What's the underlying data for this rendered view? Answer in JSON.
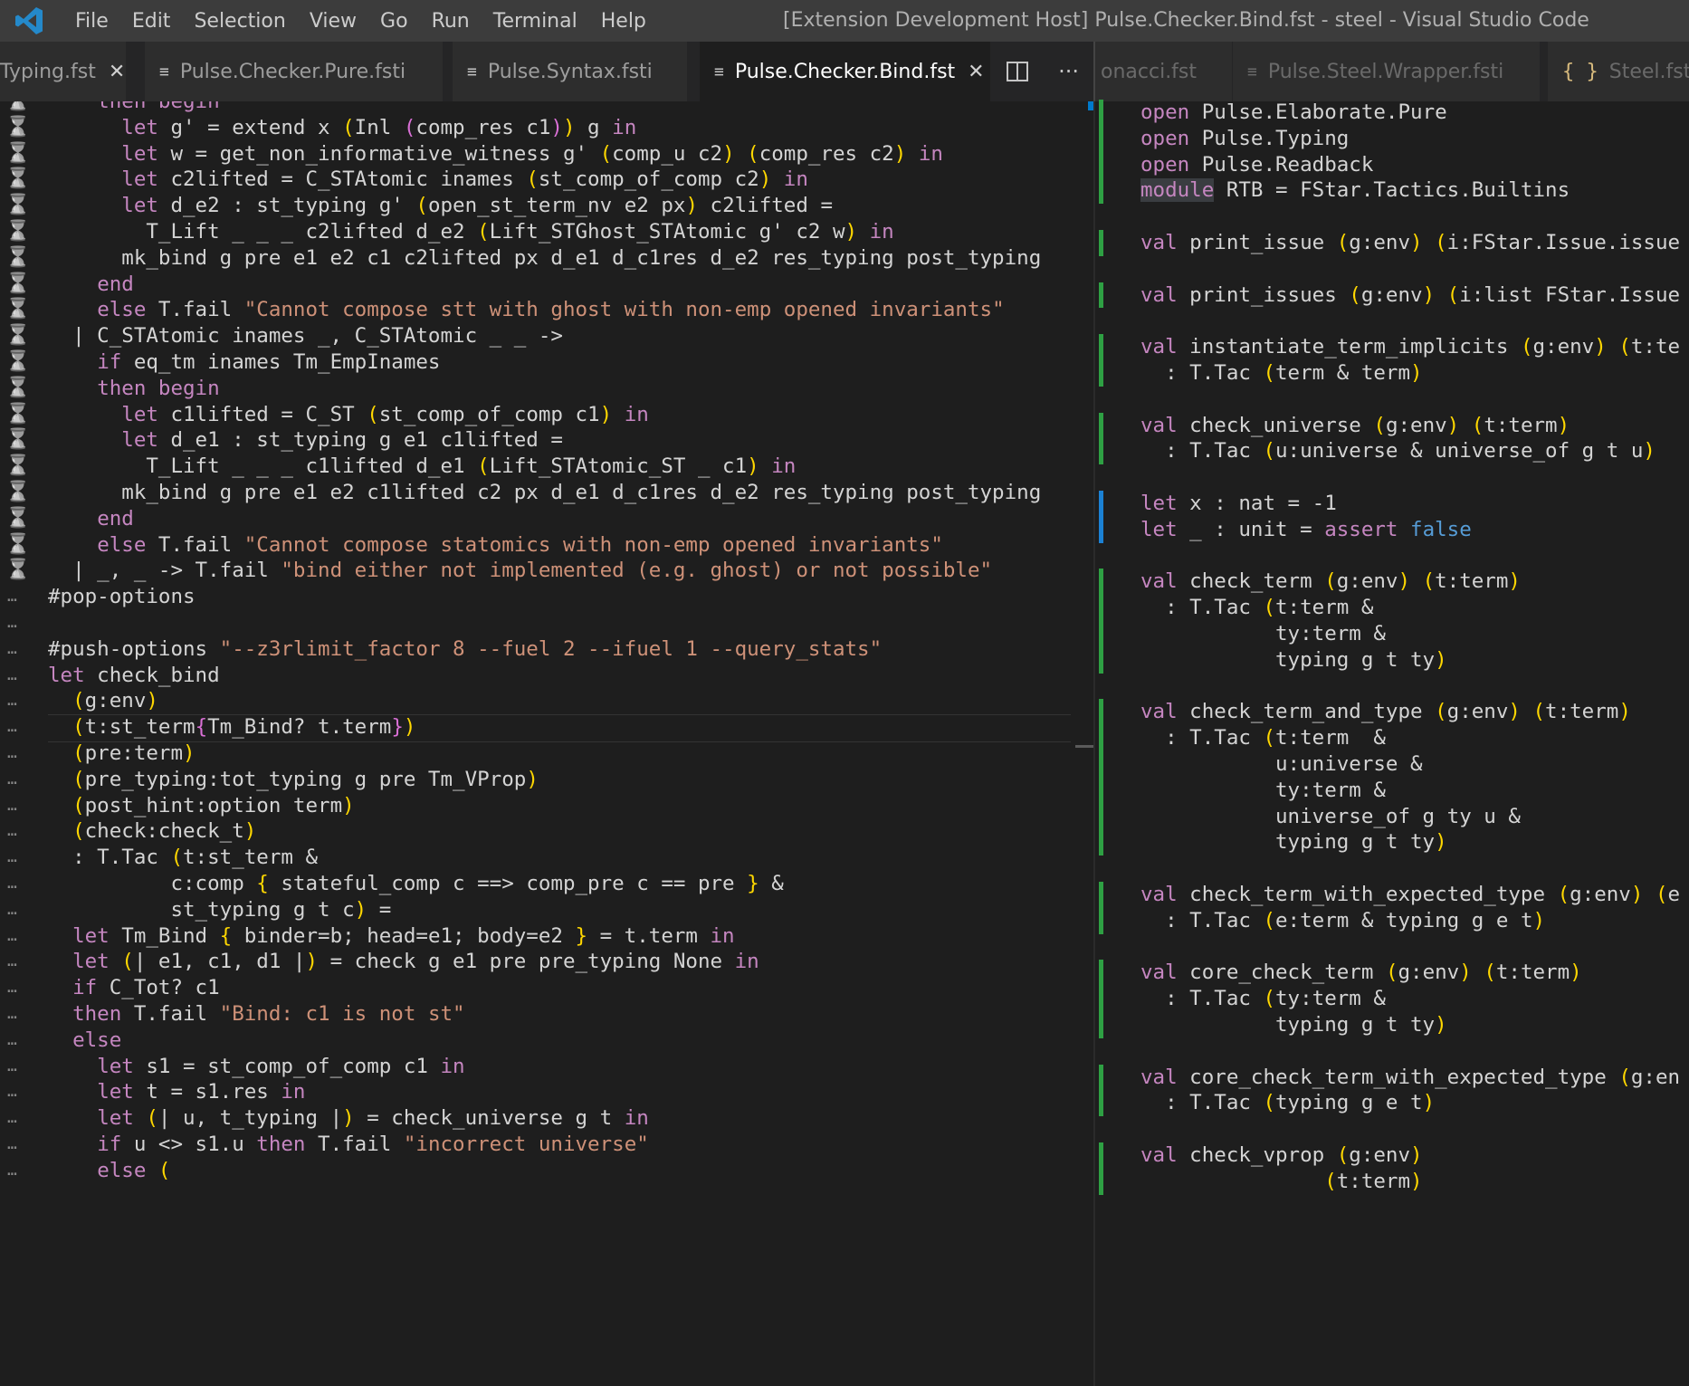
{
  "window": {
    "title": "[Extension Development Host] Pulse.Checker.Bind.fst - steel - Visual Studio Code",
    "menu": [
      "File",
      "Edit",
      "Selection",
      "View",
      "Go",
      "Run",
      "Terminal",
      "Help"
    ]
  },
  "tabs_left": [
    {
      "label": "Typing.fst",
      "close": "✕"
    },
    {
      "label": "Pulse.Checker.Pure.fsti"
    },
    {
      "label": "Pulse.Syntax.fsti"
    },
    {
      "label": "Pulse.Checker.Bind.fst",
      "close": "✕",
      "active": true
    }
  ],
  "tabs_right": [
    {
      "label": "onacci.fst"
    },
    {
      "label": "Pulse.Steel.Wrapper.fsti"
    },
    {
      "label": "Steel.fst.c",
      "icon": "{ }"
    }
  ],
  "tab_actions": {
    "split": "split-editor-icon",
    "more": "···"
  },
  "left_code": [
    "    then begin",
    "      let g' = extend x (Inl (comp_res c1)) g in",
    "      let w = get_non_informative_witness g' (comp_u c2) (comp_res c2) in",
    "      let c2lifted = C_STAtomic inames (st_comp_of_comp c2) in",
    "      let d_e2 : st_typing g' (open_st_term_nv e2 px) c2lifted =",
    "        T_Lift _ _ _ c2lifted d_e2 (Lift_STGhost_STAtomic g' c2 w) in",
    "      mk_bind g pre e1 e2 c1 c2lifted px d_e1 d_c1res d_e2 res_typing post_typing",
    "    end",
    "    else T.fail \"Cannot compose stt with ghost with non-emp opened invariants\"",
    "  | C_STAtomic inames _, C_STAtomic _ _ ->",
    "    if eq_tm inames Tm_EmpInames",
    "    then begin",
    "      let c1lifted = C_ST (st_comp_of_comp c1) in",
    "      let d_e1 : st_typing g e1 c1lifted =",
    "        T_Lift _ _ _ c1lifted d_e1 (Lift_STAtomic_ST _ c1) in",
    "      mk_bind g pre e1 e2 c1lifted c2 px d_e1 d_c1res d_e2 res_typing post_typing",
    "    end",
    "    else T.fail \"Cannot compose statomics with non-emp opened invariants\"",
    "  | _, _ -> T.fail \"bind either not implemented (e.g. ghost) or not possible\"",
    "#pop-options",
    "",
    "#push-options \"--z3rlimit_factor 8 --fuel 2 --ifuel 1 --query_stats\"",
    "let check_bind",
    "  (g:env)",
    "  (t:st_term{Tm_Bind? t.term})",
    "  (pre:term)",
    "  (pre_typing:tot_typing g pre Tm_VProp)",
    "  (post_hint:option term)",
    "  (check:check_t)",
    "  : T.Tac (t:st_term &",
    "          c:comp { stateful_comp c ==> comp_pre c == pre } &",
    "          st_typing g t c) =",
    "  let Tm_Bind { binder=b; head=e1; body=e2 } = t.term in",
    "  let (| e1, c1, d1 |) = check g e1 pre pre_typing None in",
    "  if C_Tot? c1",
    "  then T.fail \"Bind: c1 is not st\"",
    "  else",
    "    let s1 = st_comp_of_comp c1 in",
    "    let t = s1.res in",
    "    let (| u, t_typing |) = check_universe g t in",
    "    if u <> s1.u then T.fail \"incorrect universe\"",
    "    else ("
  ],
  "right_code": [
    "open Pulse.Elaborate.Pure",
    "open Pulse.Typing",
    "open Pulse.Readback",
    "module RTB = FStar.Tactics.Builtins",
    "",
    "val print_issue (g:env) (i:FStar.Issue.issue",
    "",
    "val print_issues (g:env) (i:list FStar.Issue",
    "",
    "val instantiate_term_implicits (g:env) (t:te",
    "  : T.Tac (term & term)",
    "",
    "val check_universe (g:env) (t:term)",
    "  : T.Tac (u:universe & universe_of g t u)",
    "",
    "let x : nat = -1",
    "let _ : unit = assert false",
    "",
    "val check_term (g:env) (t:term)",
    "  : T.Tac (t:term &",
    "           ty:term &",
    "           typing g t ty)",
    "",
    "val check_term_and_type (g:env) (t:term)",
    "  : T.Tac (t:term  &",
    "           u:universe &",
    "           ty:term &",
    "           universe_of g ty u &",
    "           typing g t ty)",
    "",
    "val check_term_with_expected_type (g:env) (e",
    "  : T.Tac (e:term & typing g e t)",
    "",
    "val core_check_term (g:env) (t:term)",
    "  : T.Tac (ty:term &",
    "           typing g t ty)",
    "",
    "val core_check_term_with_expected_type (g:en",
    "  : T.Tac (typing g e t)",
    "",
    "val check_vprop (g:env)",
    "               (t:term)"
  ],
  "colors": {
    "keyword": "#c586c0",
    "keyword_blue": "#569cd6",
    "string": "#ce9178",
    "bracket_gold": "#ffd700",
    "bracket_orchid": "#da70d6",
    "bracket_blue": "#179fff",
    "diff_added": "#2ea043",
    "diff_modified": "#1b81d4"
  }
}
